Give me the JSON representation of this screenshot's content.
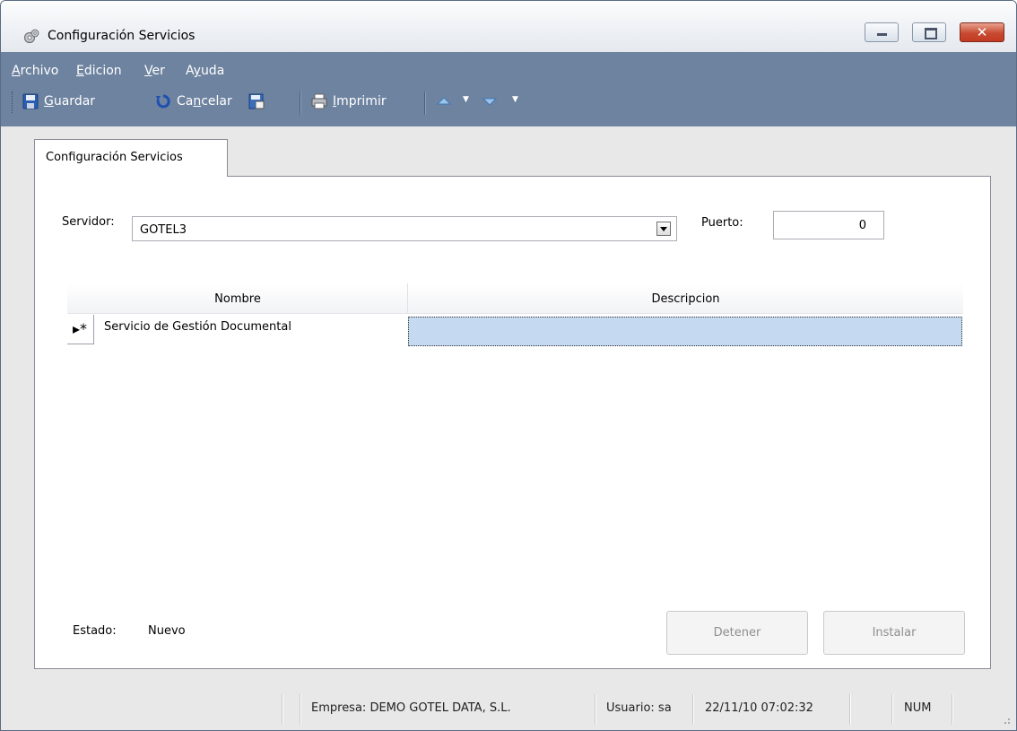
{
  "window": {
    "title": "Configuración Servicios",
    "controls": {
      "minimize": "minimize",
      "maximize": "maximize",
      "close": "✕"
    }
  },
  "menu": [
    {
      "label": "Archivo",
      "underline": "A"
    },
    {
      "label": "Edicion",
      "underline": "E"
    },
    {
      "label": "Ver",
      "underline": "V"
    },
    {
      "label": "Ayuda",
      "underline": "y"
    }
  ],
  "toolbar": {
    "save": {
      "icon": "floppy-disk-icon",
      "label": "Guardar"
    },
    "cancel": {
      "icon": "undo-icon",
      "label": "Cancelar"
    },
    "save_as": {
      "icon": "save-as-icon"
    },
    "print": {
      "icon": "printer-icon",
      "label": "Imprimir"
    },
    "nav_up": {
      "icon": "arrow-up-icon"
    },
    "nav_down": {
      "icon": "arrow-down-icon"
    }
  },
  "tab": {
    "label": "Configuración Servicios"
  },
  "form": {
    "server_label": "Servidor:",
    "server_value": "GOTEL3",
    "port_label": "Puerto:",
    "port_value": "0"
  },
  "grid": {
    "columns": [
      "Nombre",
      "Descripcion"
    ],
    "rows": [
      {
        "marker": "*",
        "nombre": "Servicio de Gestión Documental",
        "descripcion": ""
      }
    ]
  },
  "status": {
    "label": "Estado:",
    "value": "Nuevo"
  },
  "buttons": {
    "stop": "Detener",
    "install": "Instalar"
  },
  "statusbar": {
    "empresa": "Empresa: DEMO GOTEL DATA, S.L.",
    "usuario": "Usuario: sa",
    "datetime": "22/11/10 07:02:32",
    "num": "NUM"
  },
  "colors": {
    "menubar": "#6e83a0",
    "selected_cell": "#c5daf1",
    "close_button": "#c84a31"
  }
}
